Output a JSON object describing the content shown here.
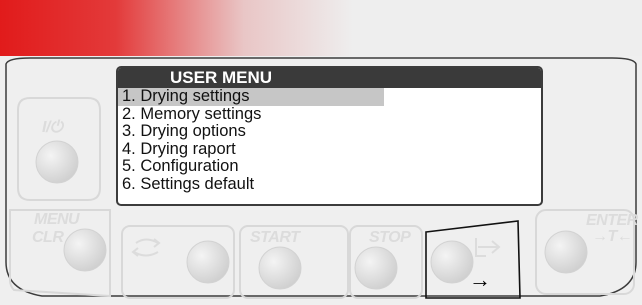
{
  "screen": {
    "title": "USER MENU",
    "selected_index": 0,
    "items": [
      {
        "label": "1. Drying settings"
      },
      {
        "label": "2. Memory settings"
      },
      {
        "label": "3. Drying options"
      },
      {
        "label": "4. Drying raport"
      },
      {
        "label": "5. Configuration"
      },
      {
        "label": "6. Settings default"
      }
    ]
  },
  "keys": {
    "power": "I/⏻",
    "menu_line1": "MENU",
    "menu_line2": "CLR",
    "return": "↶",
    "start": "START",
    "stop": "STOP",
    "enter_line1": "ENTER",
    "enter_line2": "→T←",
    "next_arrow": "→"
  },
  "colors": {
    "accent_red": "#e11b1b",
    "panel": "#efefef",
    "screen_header": "#3a3a3a",
    "selection": "#c6c6c6"
  }
}
